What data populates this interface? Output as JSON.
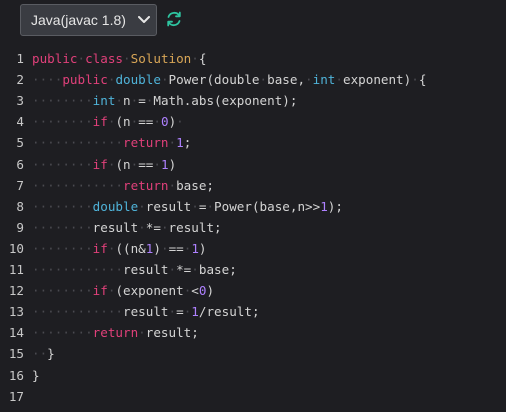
{
  "toolbar": {
    "language_label": "Java(javac 1.8)"
  },
  "editor": {
    "lines": [
      {
        "n": "1",
        "tokens": [
          [
            "kw",
            "public"
          ],
          [
            "ws",
            "·"
          ],
          [
            "kw",
            "class"
          ],
          [
            "ws",
            "·"
          ],
          [
            "cls",
            "Solution"
          ],
          [
            "ws",
            "·"
          ],
          [
            "op",
            "{"
          ]
        ]
      },
      {
        "n": "2",
        "tokens": [
          [
            "ws",
            "····"
          ],
          [
            "kw",
            "public"
          ],
          [
            "ws",
            "·"
          ],
          [
            "ty",
            "double"
          ],
          [
            "ws",
            "·"
          ],
          [
            "fn",
            "Power(double"
          ],
          [
            "ws",
            "·"
          ],
          [
            "fn",
            "base,"
          ],
          [
            "ws",
            "·"
          ],
          [
            "ty",
            "int"
          ],
          [
            "ws",
            "·"
          ],
          [
            "fn",
            "exponent)"
          ],
          [
            "ws",
            "·"
          ],
          [
            "op",
            "{"
          ]
        ]
      },
      {
        "n": "3",
        "tokens": [
          [
            "ws",
            "········"
          ],
          [
            "ty",
            "int"
          ],
          [
            "ws",
            "·"
          ],
          [
            "fn",
            "n"
          ],
          [
            "ws",
            "·"
          ],
          [
            "op",
            "="
          ],
          [
            "ws",
            "·"
          ],
          [
            "fn",
            "Math.abs(exponent);"
          ]
        ]
      },
      {
        "n": "4",
        "tokens": [
          [
            "ws",
            "········"
          ],
          [
            "kw",
            "if"
          ],
          [
            "ws",
            "·"
          ],
          [
            "op",
            "(n"
          ],
          [
            "ws",
            "·"
          ],
          [
            "op",
            "=="
          ],
          [
            "ws",
            "·"
          ],
          [
            "num",
            "0"
          ],
          [
            "op",
            ")"
          ],
          [
            "ws",
            "·"
          ]
        ]
      },
      {
        "n": "5",
        "tokens": [
          [
            "ws",
            "············"
          ],
          [
            "kw",
            "return"
          ],
          [
            "ws",
            "·"
          ],
          [
            "num",
            "1"
          ],
          [
            "op",
            ";"
          ]
        ]
      },
      {
        "n": "6",
        "tokens": [
          [
            "ws",
            "········"
          ],
          [
            "kw",
            "if"
          ],
          [
            "ws",
            "·"
          ],
          [
            "op",
            "(n"
          ],
          [
            "ws",
            "·"
          ],
          [
            "op",
            "=="
          ],
          [
            "ws",
            "·"
          ],
          [
            "num",
            "1"
          ],
          [
            "op",
            ")"
          ]
        ]
      },
      {
        "n": "7",
        "tokens": [
          [
            "ws",
            "············"
          ],
          [
            "kw",
            "return"
          ],
          [
            "ws",
            "·"
          ],
          [
            "fn",
            "base;"
          ]
        ]
      },
      {
        "n": "8",
        "tokens": [
          [
            "ws",
            "········"
          ],
          [
            "ty",
            "double"
          ],
          [
            "ws",
            "·"
          ],
          [
            "fn",
            "result"
          ],
          [
            "ws",
            "·"
          ],
          [
            "op",
            "="
          ],
          [
            "ws",
            "·"
          ],
          [
            "fn",
            "Power(base,n>>"
          ],
          [
            "num",
            "1"
          ],
          [
            "op",
            ");"
          ]
        ]
      },
      {
        "n": "9",
        "tokens": [
          [
            "ws",
            "········"
          ],
          [
            "fn",
            "result"
          ],
          [
            "ws",
            "·"
          ],
          [
            "op",
            "*="
          ],
          [
            "ws",
            "·"
          ],
          [
            "fn",
            "result;"
          ]
        ]
      },
      {
        "n": "10",
        "tokens": [
          [
            "ws",
            "········"
          ],
          [
            "kw",
            "if"
          ],
          [
            "ws",
            "·"
          ],
          [
            "op",
            "((n&"
          ],
          [
            "num",
            "1"
          ],
          [
            "op",
            ")"
          ],
          [
            "ws",
            "·"
          ],
          [
            "op",
            "=="
          ],
          [
            "ws",
            "·"
          ],
          [
            "num",
            "1"
          ],
          [
            "op",
            ")"
          ]
        ]
      },
      {
        "n": "11",
        "tokens": [
          [
            "ws",
            "············"
          ],
          [
            "fn",
            "result"
          ],
          [
            "ws",
            "·"
          ],
          [
            "op",
            "*="
          ],
          [
            "ws",
            "·"
          ],
          [
            "fn",
            "base;"
          ]
        ]
      },
      {
        "n": "12",
        "tokens": [
          [
            "ws",
            "········"
          ],
          [
            "kw",
            "if"
          ],
          [
            "ws",
            "·"
          ],
          [
            "op",
            "(exponent"
          ],
          [
            "ws",
            "·"
          ],
          [
            "op",
            "<"
          ],
          [
            "num",
            "0"
          ],
          [
            "op",
            ")"
          ]
        ]
      },
      {
        "n": "13",
        "tokens": [
          [
            "ws",
            "············"
          ],
          [
            "fn",
            "result"
          ],
          [
            "ws",
            "·"
          ],
          [
            "op",
            "="
          ],
          [
            "ws",
            "·"
          ],
          [
            "num",
            "1"
          ],
          [
            "op",
            "/result;"
          ]
        ]
      },
      {
        "n": "14",
        "tokens": [
          [
            "ws",
            "········"
          ],
          [
            "kw",
            "return"
          ],
          [
            "ws",
            "·"
          ],
          [
            "fn",
            "result;"
          ]
        ]
      },
      {
        "n": "15",
        "tokens": [
          [
            "ws",
            "··"
          ],
          [
            "op",
            "}"
          ]
        ]
      },
      {
        "n": "16",
        "tokens": [
          [
            "op",
            "}"
          ]
        ]
      },
      {
        "n": "17",
        "tokens": []
      }
    ]
  },
  "colors": {
    "background": "#1e1e22",
    "keyword": "#e0407a",
    "type": "#4fb3d9",
    "number": "#ae81ff",
    "refresh_icon": "#2ec4a0"
  },
  "icons": {
    "dropdown": "chevron-down-icon",
    "refresh": "refresh-icon"
  }
}
